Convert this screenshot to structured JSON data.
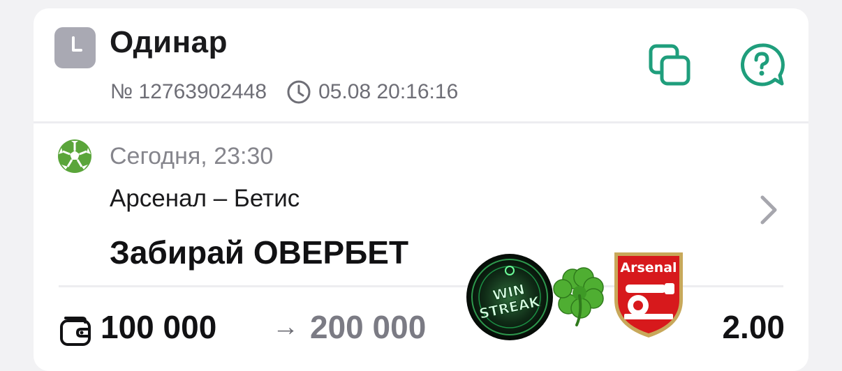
{
  "bet": {
    "type_label": "Одинар",
    "number": "№ 12763902448",
    "datetime": "05.08 20:16:16"
  },
  "event": {
    "time": "Сегодня, 23:30",
    "teams": "Арсенал – Бетис",
    "market": "Забирай ОВЕРБЕТ"
  },
  "amounts": {
    "stake": "100 000",
    "arrow": "→",
    "payout": "200 000",
    "odds": "2.00"
  },
  "stickers": {
    "winstreak_line1": "WIN",
    "winstreak_line2": "STREAK",
    "arsenal_text": "Arsenal"
  },
  "colors": {
    "accent": "#1f9e7c",
    "ball_green": "#5aa53a",
    "arsenal_red": "#d7191c"
  },
  "icons": {
    "bet_type": "clock-icon",
    "meta_clock": "clock-outline-icon",
    "copy": "copy-icon",
    "help": "help-bubble-icon",
    "sport": "soccer-ball-icon",
    "chevron": "chevron-right-icon",
    "wallet": "wallet-icon"
  }
}
